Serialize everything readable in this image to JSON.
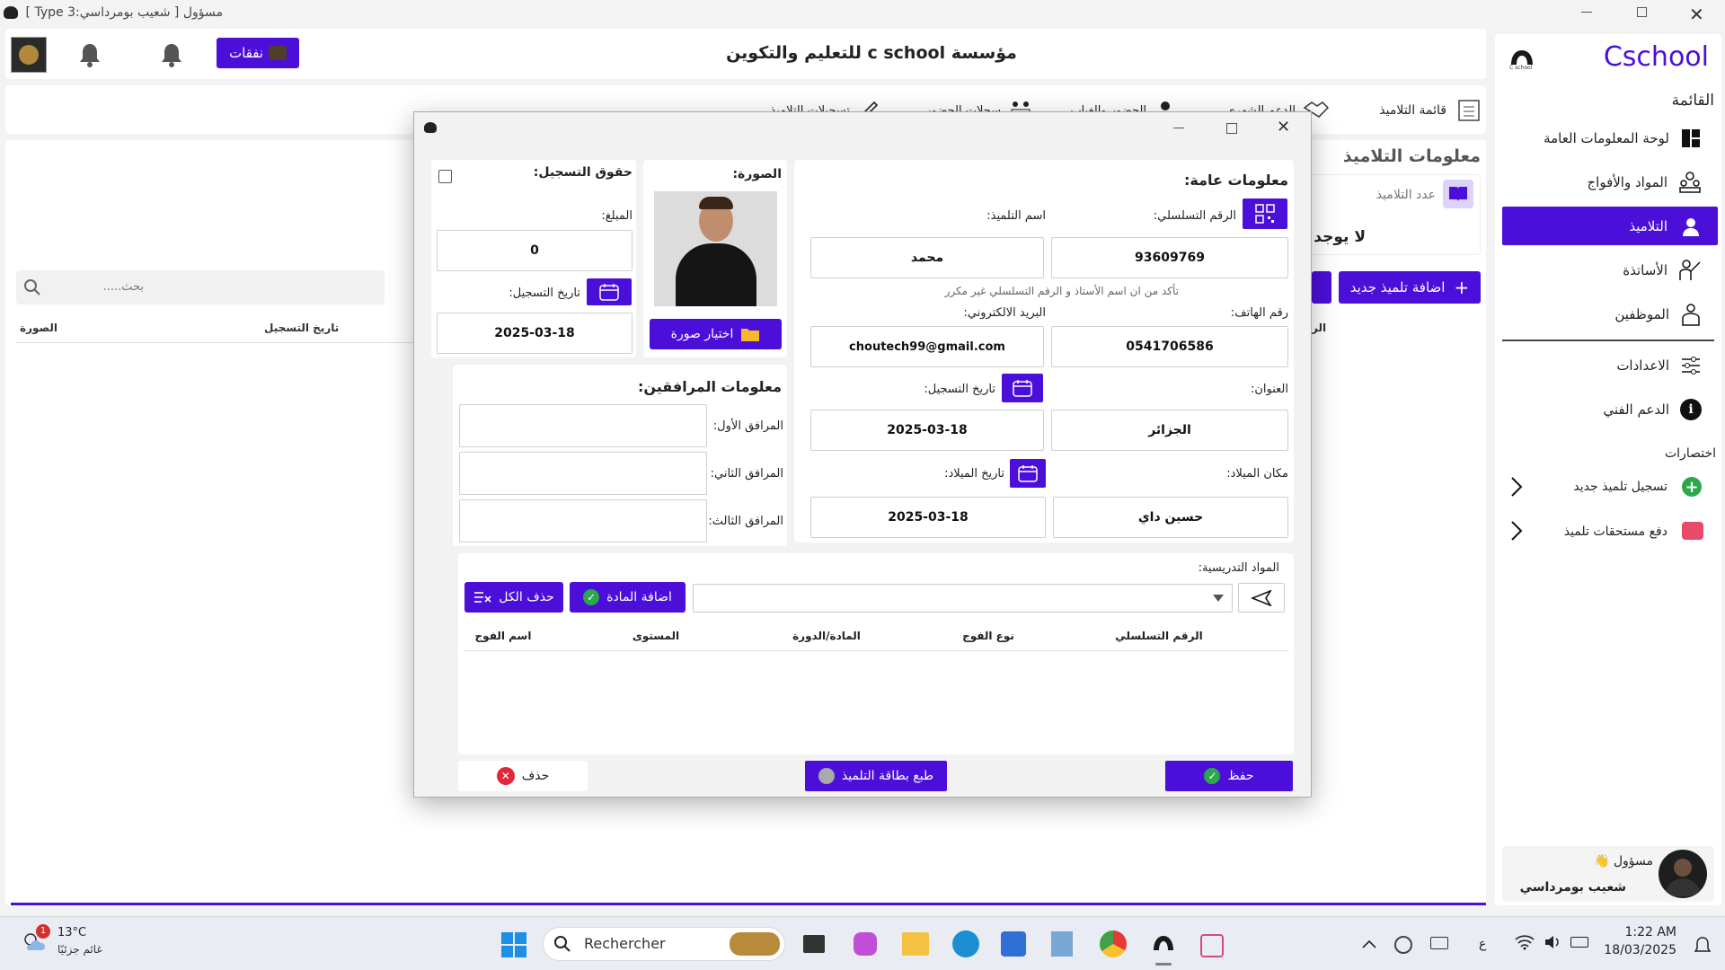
{
  "window": {
    "title": "مسؤول [ شعيب بومرداسي:Type 3 ]"
  },
  "header": {
    "institution": "مؤسسة c school للتعليم والتكوين",
    "expenses_button": "نفقات"
  },
  "sidebar": {
    "brand": "Cschool",
    "logo_caption": "C school",
    "menu_title": "القائمة",
    "items": [
      {
        "label": "لوحة المعلومات العامة",
        "icon": "dashboard-icon"
      },
      {
        "label": "المواد والأفواج",
        "icon": "groups-icon"
      },
      {
        "label": "التلاميذ",
        "icon": "student-icon",
        "active": true
      },
      {
        "label": "الأساتذة",
        "icon": "teacher-icon"
      },
      {
        "label": "الموظفين",
        "icon": "employees-icon"
      }
    ],
    "settings_label": "الاعدادات",
    "support_label": "الدعم الفني",
    "shortcuts_title": "اختصارات",
    "shortcuts": [
      {
        "label": "تسجيل تلميذ جديد",
        "icon": "plus-circle-icon"
      },
      {
        "label": "دفع مستحقات تلميذ",
        "icon": "card-icon"
      }
    ],
    "user": {
      "role": "مسؤول",
      "name": "شعيب بومرداسي"
    }
  },
  "tabs": [
    "قائمة التلاميذ",
    "الدعم الشهري",
    "الحضور والغياب",
    "سجلات الحضور",
    "تسجيلات التلاميذ"
  ],
  "students_page": {
    "title": "معلومات التلاميذ",
    "count_label": "عدد التلاميذ",
    "empty_text": "لا يوجد",
    "add_button": "اضافة تلميذ جديد",
    "search_placeholder": "بحث.....",
    "columns": [
      "الصورة",
      "تاريخ التسجيل",
      "الر"
    ]
  },
  "dialog": {
    "general": {
      "title": "معلومات عامة:",
      "serial_label": "الرقم التسلسلي:",
      "serial_value": "93609769",
      "name_label": "اسم التلميذ:",
      "name_value": "محمد",
      "hint": "تأكد من ان اسم الأستاذ و الرقم التسلسلي غير مكرر",
      "phone_label": "رقم الهاتف:",
      "phone_value": "0541706586",
      "email_label": "البريد الالكتروني:",
      "email_value": "choutech99@gmail.com",
      "address_label": "العنوان:",
      "address_value": "الجزائر",
      "reg_date_label": "تاريخ التسجيل:",
      "reg_date_value": "2025-03-18",
      "birthplace_label": "مكان الميلاد:",
      "birthplace_value": "حسين داي",
      "birthdate_label": "تاريخ الميلاد:",
      "birthdate_value": "2025-03-18"
    },
    "photo": {
      "title": "الصورة:",
      "choose_button": "اختيار صورة"
    },
    "fees": {
      "title": "حقوق التسجيل:",
      "amount_label": "المبلغ:",
      "amount_value": "0",
      "date_label": "تاريخ التسجيل:",
      "date_value": "2025-03-18"
    },
    "companions": {
      "title": "معلومات المرافقين:",
      "first": "المرافق الأول:",
      "second": "المرافق الثاني:",
      "third": "المرافق الثالث:"
    },
    "subjects": {
      "title": "المواد التدريسية:",
      "add_button": "اضافة المادة",
      "delete_all_button": "حذف الكل",
      "columns": [
        "الرقم التسلسلي",
        "نوع الفوج",
        "المادة/الدورة",
        "المستوى",
        "اسم الفوج"
      ]
    },
    "buttons": {
      "save": "حفظ",
      "print": "طبع بطاقة التلميذ",
      "delete": "حذف"
    }
  },
  "taskbar": {
    "weather_temp": "13°C",
    "weather_desc": "غائم جزئيًا",
    "weather_badge": "1",
    "search_placeholder": "Rechercher",
    "lang": "ع",
    "time": "1:22 AM",
    "date": "18/03/2025"
  },
  "colors": {
    "accent": "#4b0fd9",
    "background": "#f3f3f3"
  }
}
